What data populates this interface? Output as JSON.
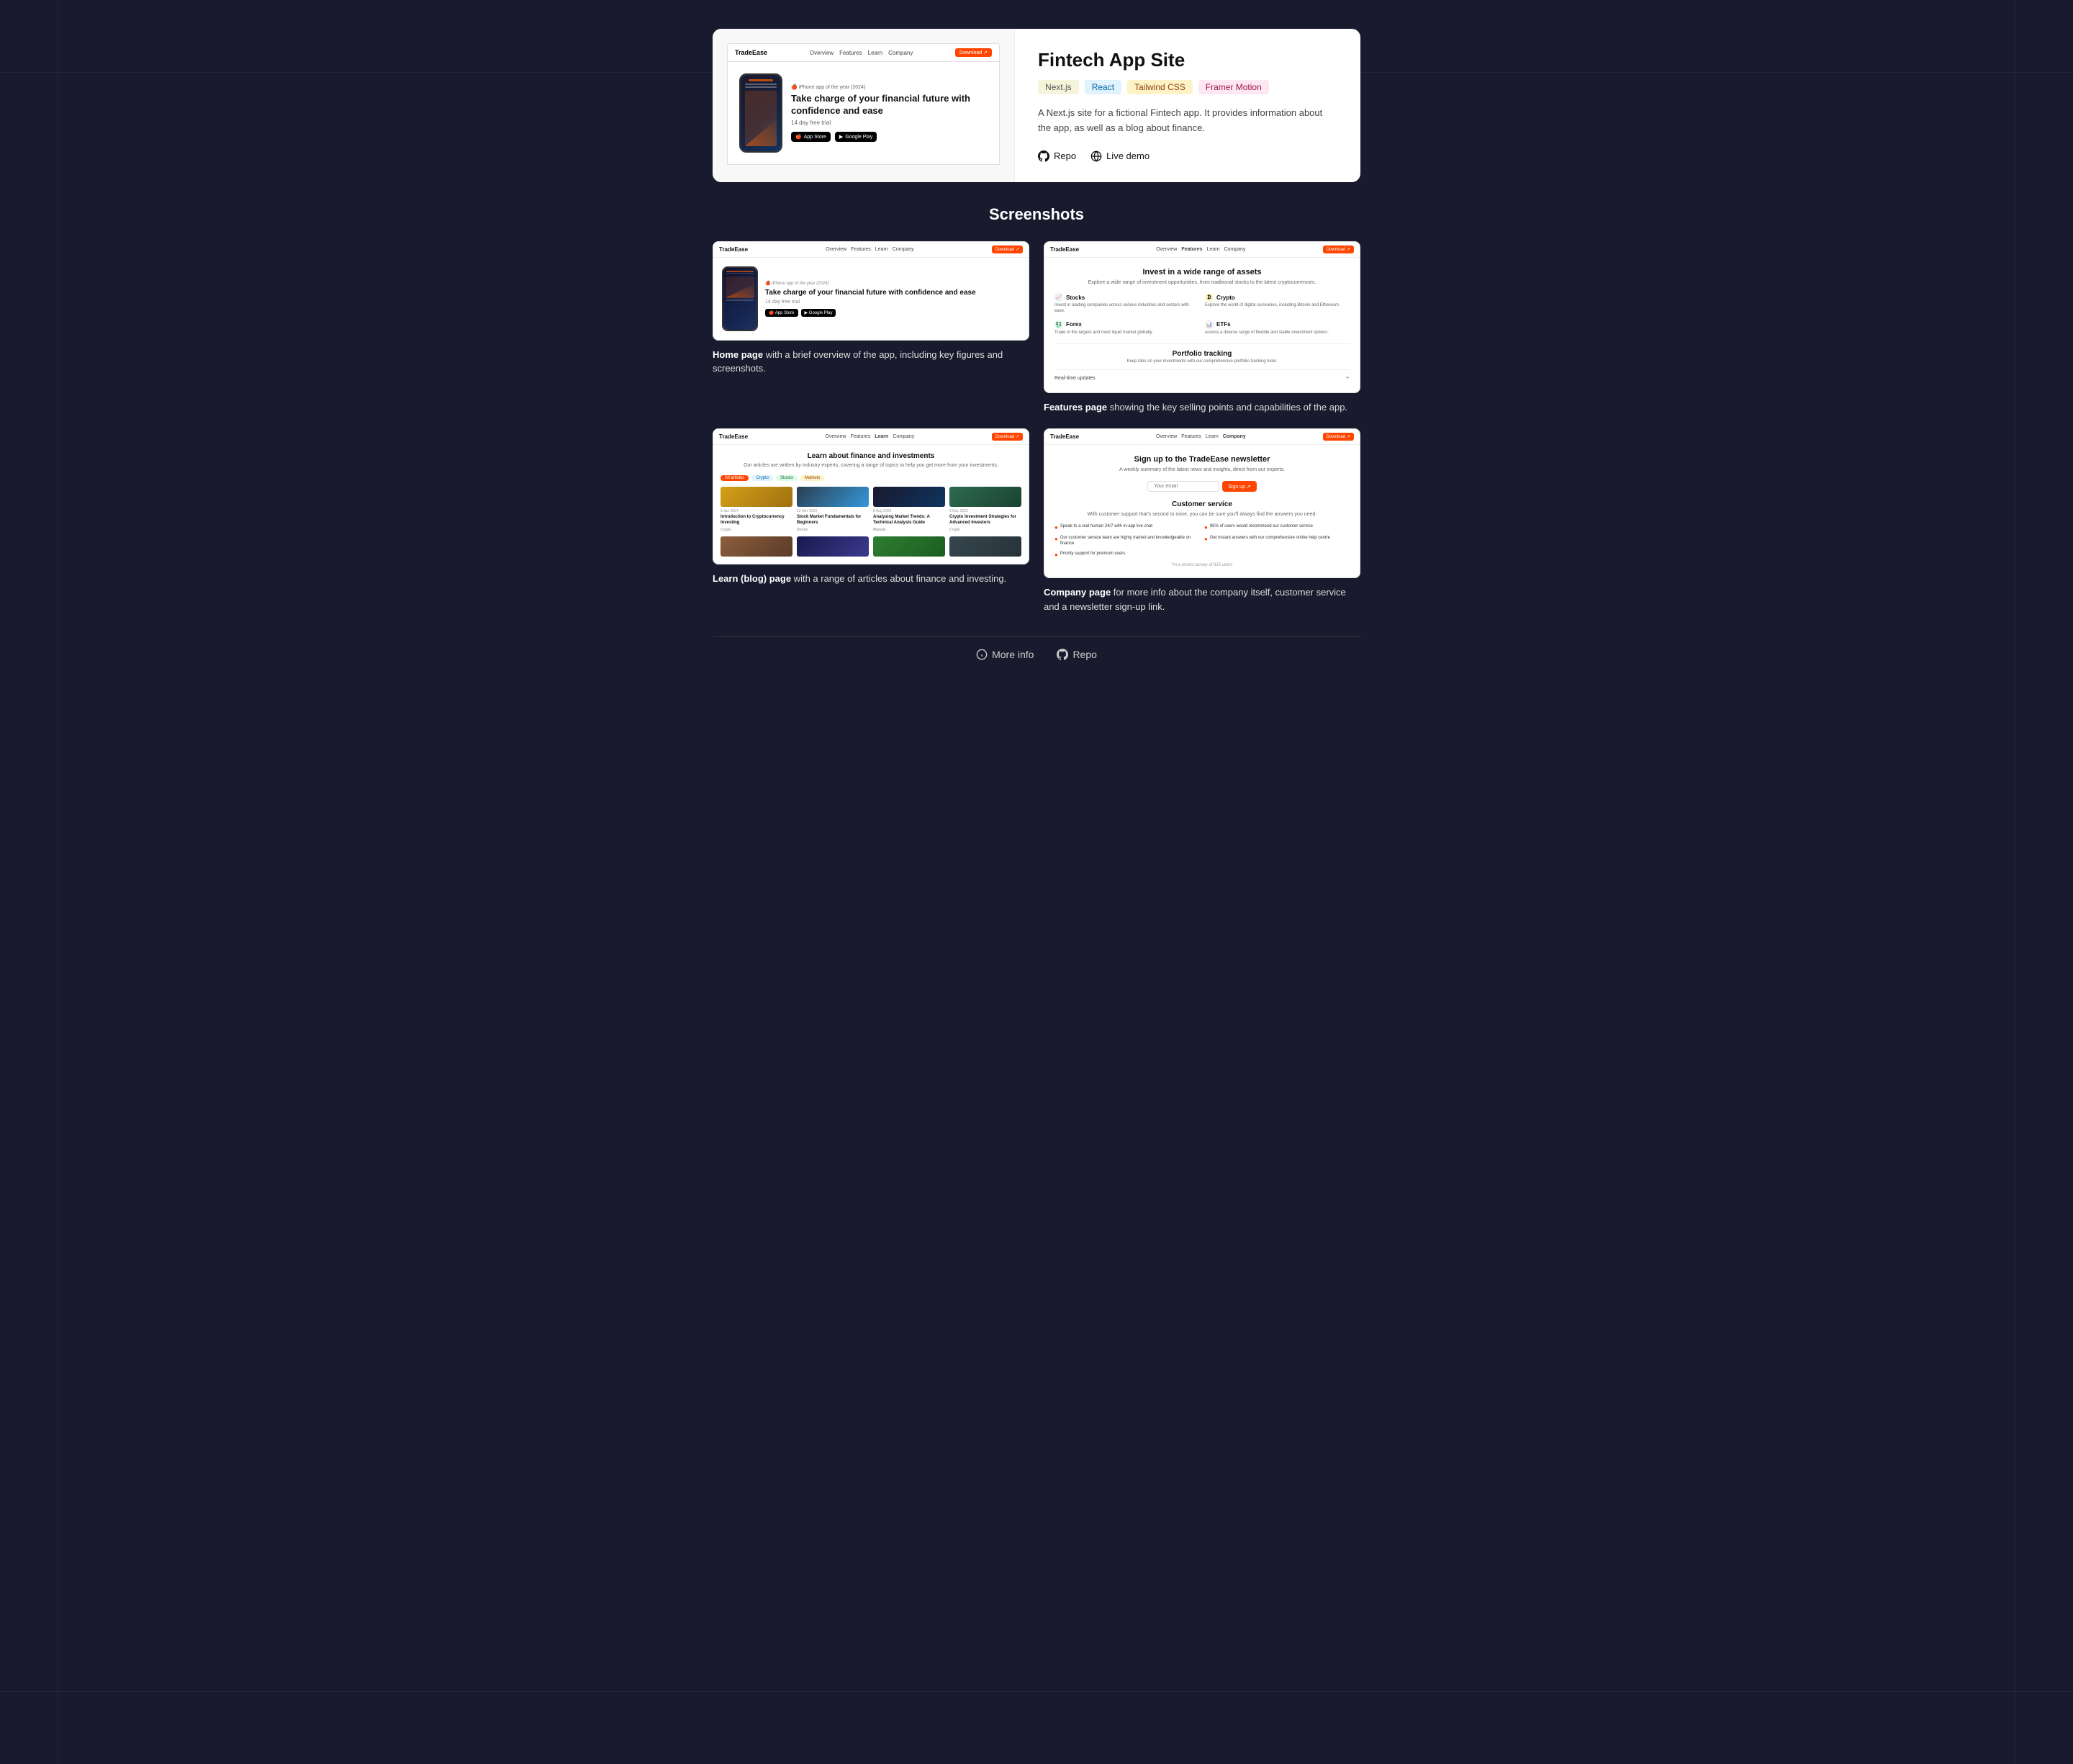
{
  "page": {
    "title": "Fintech App Site",
    "screenshots_section_title": "Screenshots"
  },
  "project": {
    "title": "Fintech App Site",
    "description": "A Next.js site for a fictional Fintech app. It provides information about the app, as well as a blog about finance.",
    "tags": [
      {
        "label": "Next.js",
        "class": "tag-nextjs"
      },
      {
        "label": "React",
        "class": "tag-react"
      },
      {
        "label": "Tailwind CSS",
        "class": "tag-tailwind"
      },
      {
        "label": "Framer Motion",
        "class": "tag-framer"
      }
    ],
    "links": {
      "repo_label": "Repo",
      "live_demo_label": "Live demo"
    }
  },
  "app_mockup": {
    "nav_logo": "TradeEase",
    "nav_links": [
      "Overview",
      "Features",
      "Learn",
      "Company"
    ],
    "nav_btn": "Download ↗",
    "award": "🍎 iPhone app of the year (2024)",
    "headline": "Take charge of your financial future with confidence and ease",
    "subtext": "14 day free trial",
    "badges": {
      "app_store": "App Store",
      "google_play": "Google Play"
    }
  },
  "screenshots": [
    {
      "id": "home",
      "nav_logo": "TradeEase",
      "nav_links": [
        "Overview",
        "Features",
        "Learn",
        "Company"
      ],
      "nav_btn": "Download ↗",
      "headline": "Take charge of your financial future with confidence and ease",
      "award": "🍎 iPhone app of the year (2024)",
      "subtext": "14 day free trial",
      "caption_bold": "Home page",
      "caption": " with a brief overview of the app, including key figures and screenshots."
    },
    {
      "id": "features",
      "nav_logo": "TradeEase",
      "nav_links": [
        "Overview",
        "Features",
        "Learn",
        "Company"
      ],
      "nav_btn": "Download ↗",
      "title": "Invest in a wide range of assets",
      "subtitle": "Explore a wide range of investment opportunities, from traditional stocks to the latest cryptocurrencies.",
      "features": [
        {
          "name": "Stocks",
          "desc": "Invest in leading companies across various industries and sectors with ease.",
          "icon": "📈",
          "class": "stocks"
        },
        {
          "name": "Crypto",
          "desc": "Explore the world of digital currencies, including Bitcoin and Ethereum.",
          "icon": "₿",
          "class": "crypto"
        },
        {
          "name": "Forex",
          "desc": "Trade in the largest and most liquid market globally.",
          "icon": "💱",
          "class": "forex"
        },
        {
          "name": "ETFs",
          "desc": "Access a diverse range of flexible and stable investment options.",
          "icon": "📊",
          "class": "etfs"
        }
      ],
      "portfolio_title": "Portfolio tracking",
      "portfolio_desc": "Keep tabs on your investments with our comprehensive portfolio tracking tools.",
      "realtime": "Real-time updates",
      "caption_bold": "Features page",
      "caption": " showing the key selling points and capabilities of the app."
    },
    {
      "id": "blog",
      "nav_logo": "TradeEase",
      "nav_links": [
        "Overview",
        "Features",
        "Learn",
        "Company"
      ],
      "nav_btn": "Download ↗",
      "title": "Learn about finance and investments",
      "subtitle": "Our articles are written by industry experts, covering a range of topics to help you get more from your investments.",
      "filter_tags": [
        "All articles",
        "Crypto",
        "Stocks",
        "Markets"
      ],
      "articles": [
        {
          "date": "6 Jan 2024",
          "title": "Introduction to Cryptocurrency Investing",
          "cat": "Crypto",
          "img": "img1"
        },
        {
          "date": "12 Nov 2022",
          "title": "Stock Market Fundamentals for Beginners",
          "cat": "Stocks",
          "img": "img2"
        },
        {
          "date": "8 Aug 2023",
          "title": "Analysing Market Trends: A Technical Analysis Guide",
          "cat": "Markets",
          "img": "img3"
        },
        {
          "date": "6 Dec 2023",
          "title": "Crypto Investment Strategies for Advanced Investors",
          "cat": "Crypto",
          "img": "img4"
        }
      ],
      "caption_bold": "Learn (blog) page",
      "caption": " with a range of articles about finance and investing."
    },
    {
      "id": "company",
      "nav_logo": "TradeEase",
      "nav_links": [
        "Overview",
        "Features",
        "Learn",
        "Company"
      ],
      "nav_btn": "Download ↗",
      "newsletter_title": "Sign up to the TradeEase newsletter",
      "newsletter_subtitle": "A weekly summary of the latest news and insights, direct from our experts.",
      "newsletter_placeholder": "Your email",
      "newsletter_btn": "Sign up ↗",
      "cs_title": "Customer service",
      "cs_desc": "With customer support that's second to none, you can be sure you'll always find the answers you need.",
      "cs_features": [
        "Speak to a real human 24/7 with in-app live chat",
        "95% of users would recommend our customer service",
        "Our customer service team are highly trained and knowledgeable on finance",
        "Get instant answers with our comprehensive online help centre",
        "Priority support for premium users",
        ""
      ],
      "cs_note": "*In a recent survey of 925 users",
      "caption_bold": "Company page",
      "caption": " for more info about the company itself, customer service and a newsletter sign-up link."
    }
  ],
  "footer": {
    "more_info_label": "More info",
    "repo_label": "Repo"
  }
}
